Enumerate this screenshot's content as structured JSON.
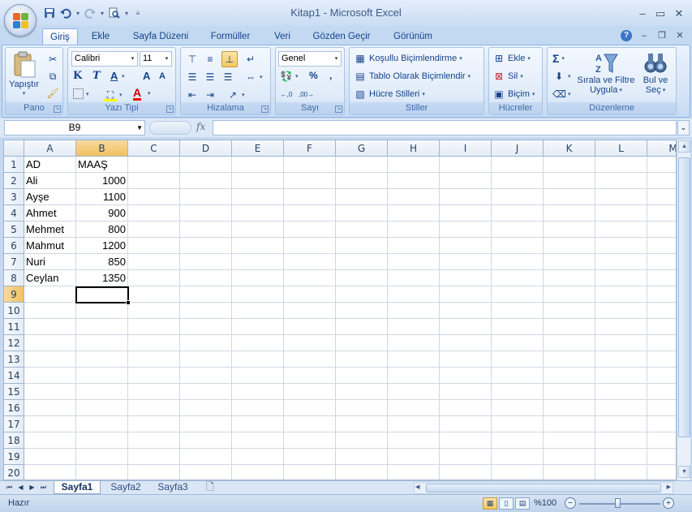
{
  "window": {
    "title": "Kitap1 - Microsoft Excel"
  },
  "tabs": [
    {
      "label": "Giriş",
      "active": true
    },
    {
      "label": "Ekle"
    },
    {
      "label": "Sayfa Düzeni"
    },
    {
      "label": "Formüller"
    },
    {
      "label": "Veri"
    },
    {
      "label": "Gözden Geçir"
    },
    {
      "label": "Görünüm"
    }
  ],
  "ribbon": {
    "pano": {
      "label": "Pano",
      "paste_label": "Yapıştır"
    },
    "font": {
      "label": "Yazı Tipi",
      "font_name": "Calibri",
      "font_size": "11",
      "bold": "K",
      "italic": "T",
      "underline": "A",
      "grow": "A",
      "shrink": "A",
      "color_letter": "A"
    },
    "align": {
      "label": "Hizalama"
    },
    "number": {
      "label": "Sayı",
      "format": "Genel",
      "percent": "%",
      "comma": ","
    },
    "styles": {
      "label": "Stiller",
      "conditional": "Koşullu Biçimlendirme",
      "table": "Tablo Olarak Biçimlendir",
      "cell_styles": "Hücre Stilleri"
    },
    "cells": {
      "label": "Hücreler",
      "insert": "Ekle",
      "delete": "Sil",
      "format": "Biçim"
    },
    "editing": {
      "label": "Düzenleme",
      "sum": "Σ",
      "sort_line1": "Sırala ve Filtre",
      "sort_line2": "Uygula",
      "find_line1": "Bul ve",
      "find_line2": "Seç"
    }
  },
  "formula_bar": {
    "name_box": "B9",
    "fx": "fx",
    "content": ""
  },
  "sheet": {
    "columns": [
      "A",
      "B",
      "C",
      "D",
      "E",
      "F",
      "G",
      "H",
      "I",
      "J",
      "K",
      "L",
      "M"
    ],
    "rows": [
      "1",
      "2",
      "3",
      "4",
      "5",
      "6",
      "7",
      "8",
      "9",
      "10",
      "11",
      "12",
      "13",
      "14",
      "15",
      "16",
      "17",
      "18",
      "19",
      "20"
    ],
    "selected_cell": "B9",
    "cells": {
      "A1": "AD",
      "B1": "MAAŞ",
      "A2": "Ali",
      "B2": "1000",
      "A3": "Ayşe",
      "B3": "1100",
      "A4": "Ahmet",
      "B4": "900",
      "A5": "Mehmet",
      "B5": "800",
      "A6": "Mahmut",
      "B6": "1200",
      "A7": "Nuri",
      "B7": "850",
      "A8": "Ceylan",
      "B8": "1350"
    }
  },
  "sheet_tabs": [
    {
      "label": "Sayfa1",
      "active": true
    },
    {
      "label": "Sayfa2"
    },
    {
      "label": "Sayfa3"
    }
  ],
  "status": {
    "text": "Hazır",
    "zoom": "%100"
  }
}
